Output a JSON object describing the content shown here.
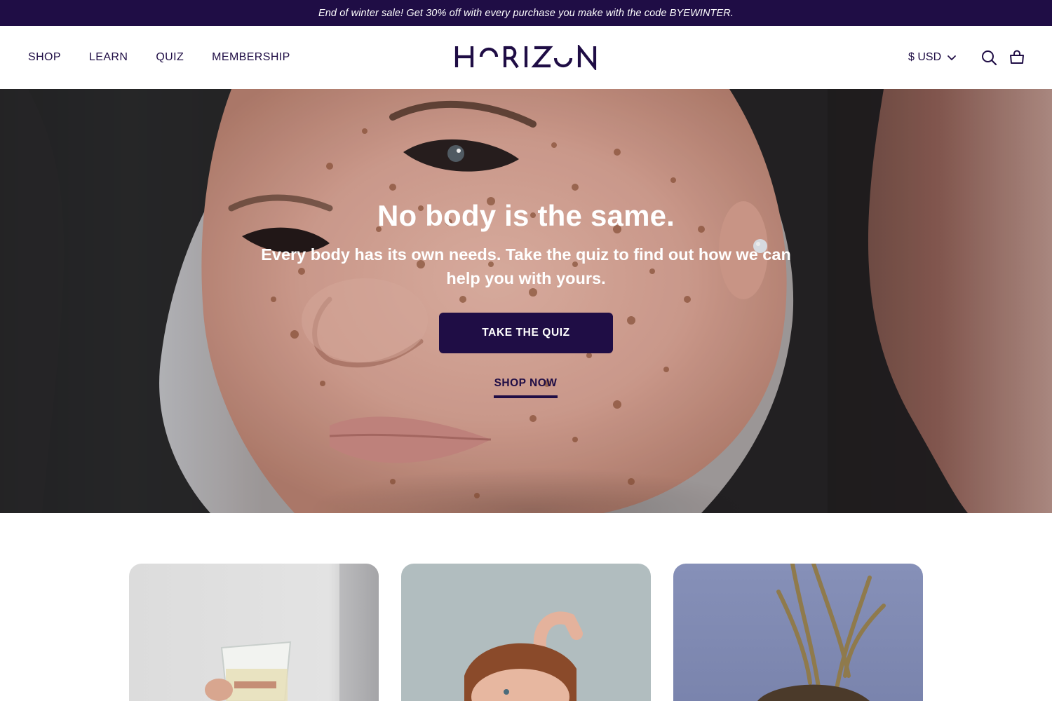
{
  "announcement": {
    "text": "End of winter sale! Get 30% off with every purchase you make with the code BYEWINTER."
  },
  "nav": {
    "items": [
      {
        "label": "SHOP"
      },
      {
        "label": "LEARN"
      },
      {
        "label": "QUIZ"
      },
      {
        "label": "MEMBERSHIP"
      }
    ]
  },
  "brand": {
    "name": "HORIZON"
  },
  "header": {
    "currency": "$ USD",
    "icons": [
      "search-icon",
      "cart-icon",
      "chevron-down-icon"
    ]
  },
  "hero": {
    "title": "No body is the same.",
    "subtitle": "Every body has its own needs. Take the quiz to find out how we can help you with yours.",
    "primary_cta": "TAKE THE QUIZ",
    "secondary_cta": "SHOP NOW"
  },
  "colors": {
    "brand": "#1f0d45",
    "background": "#ffffff",
    "hero_text": "#ffffff"
  }
}
